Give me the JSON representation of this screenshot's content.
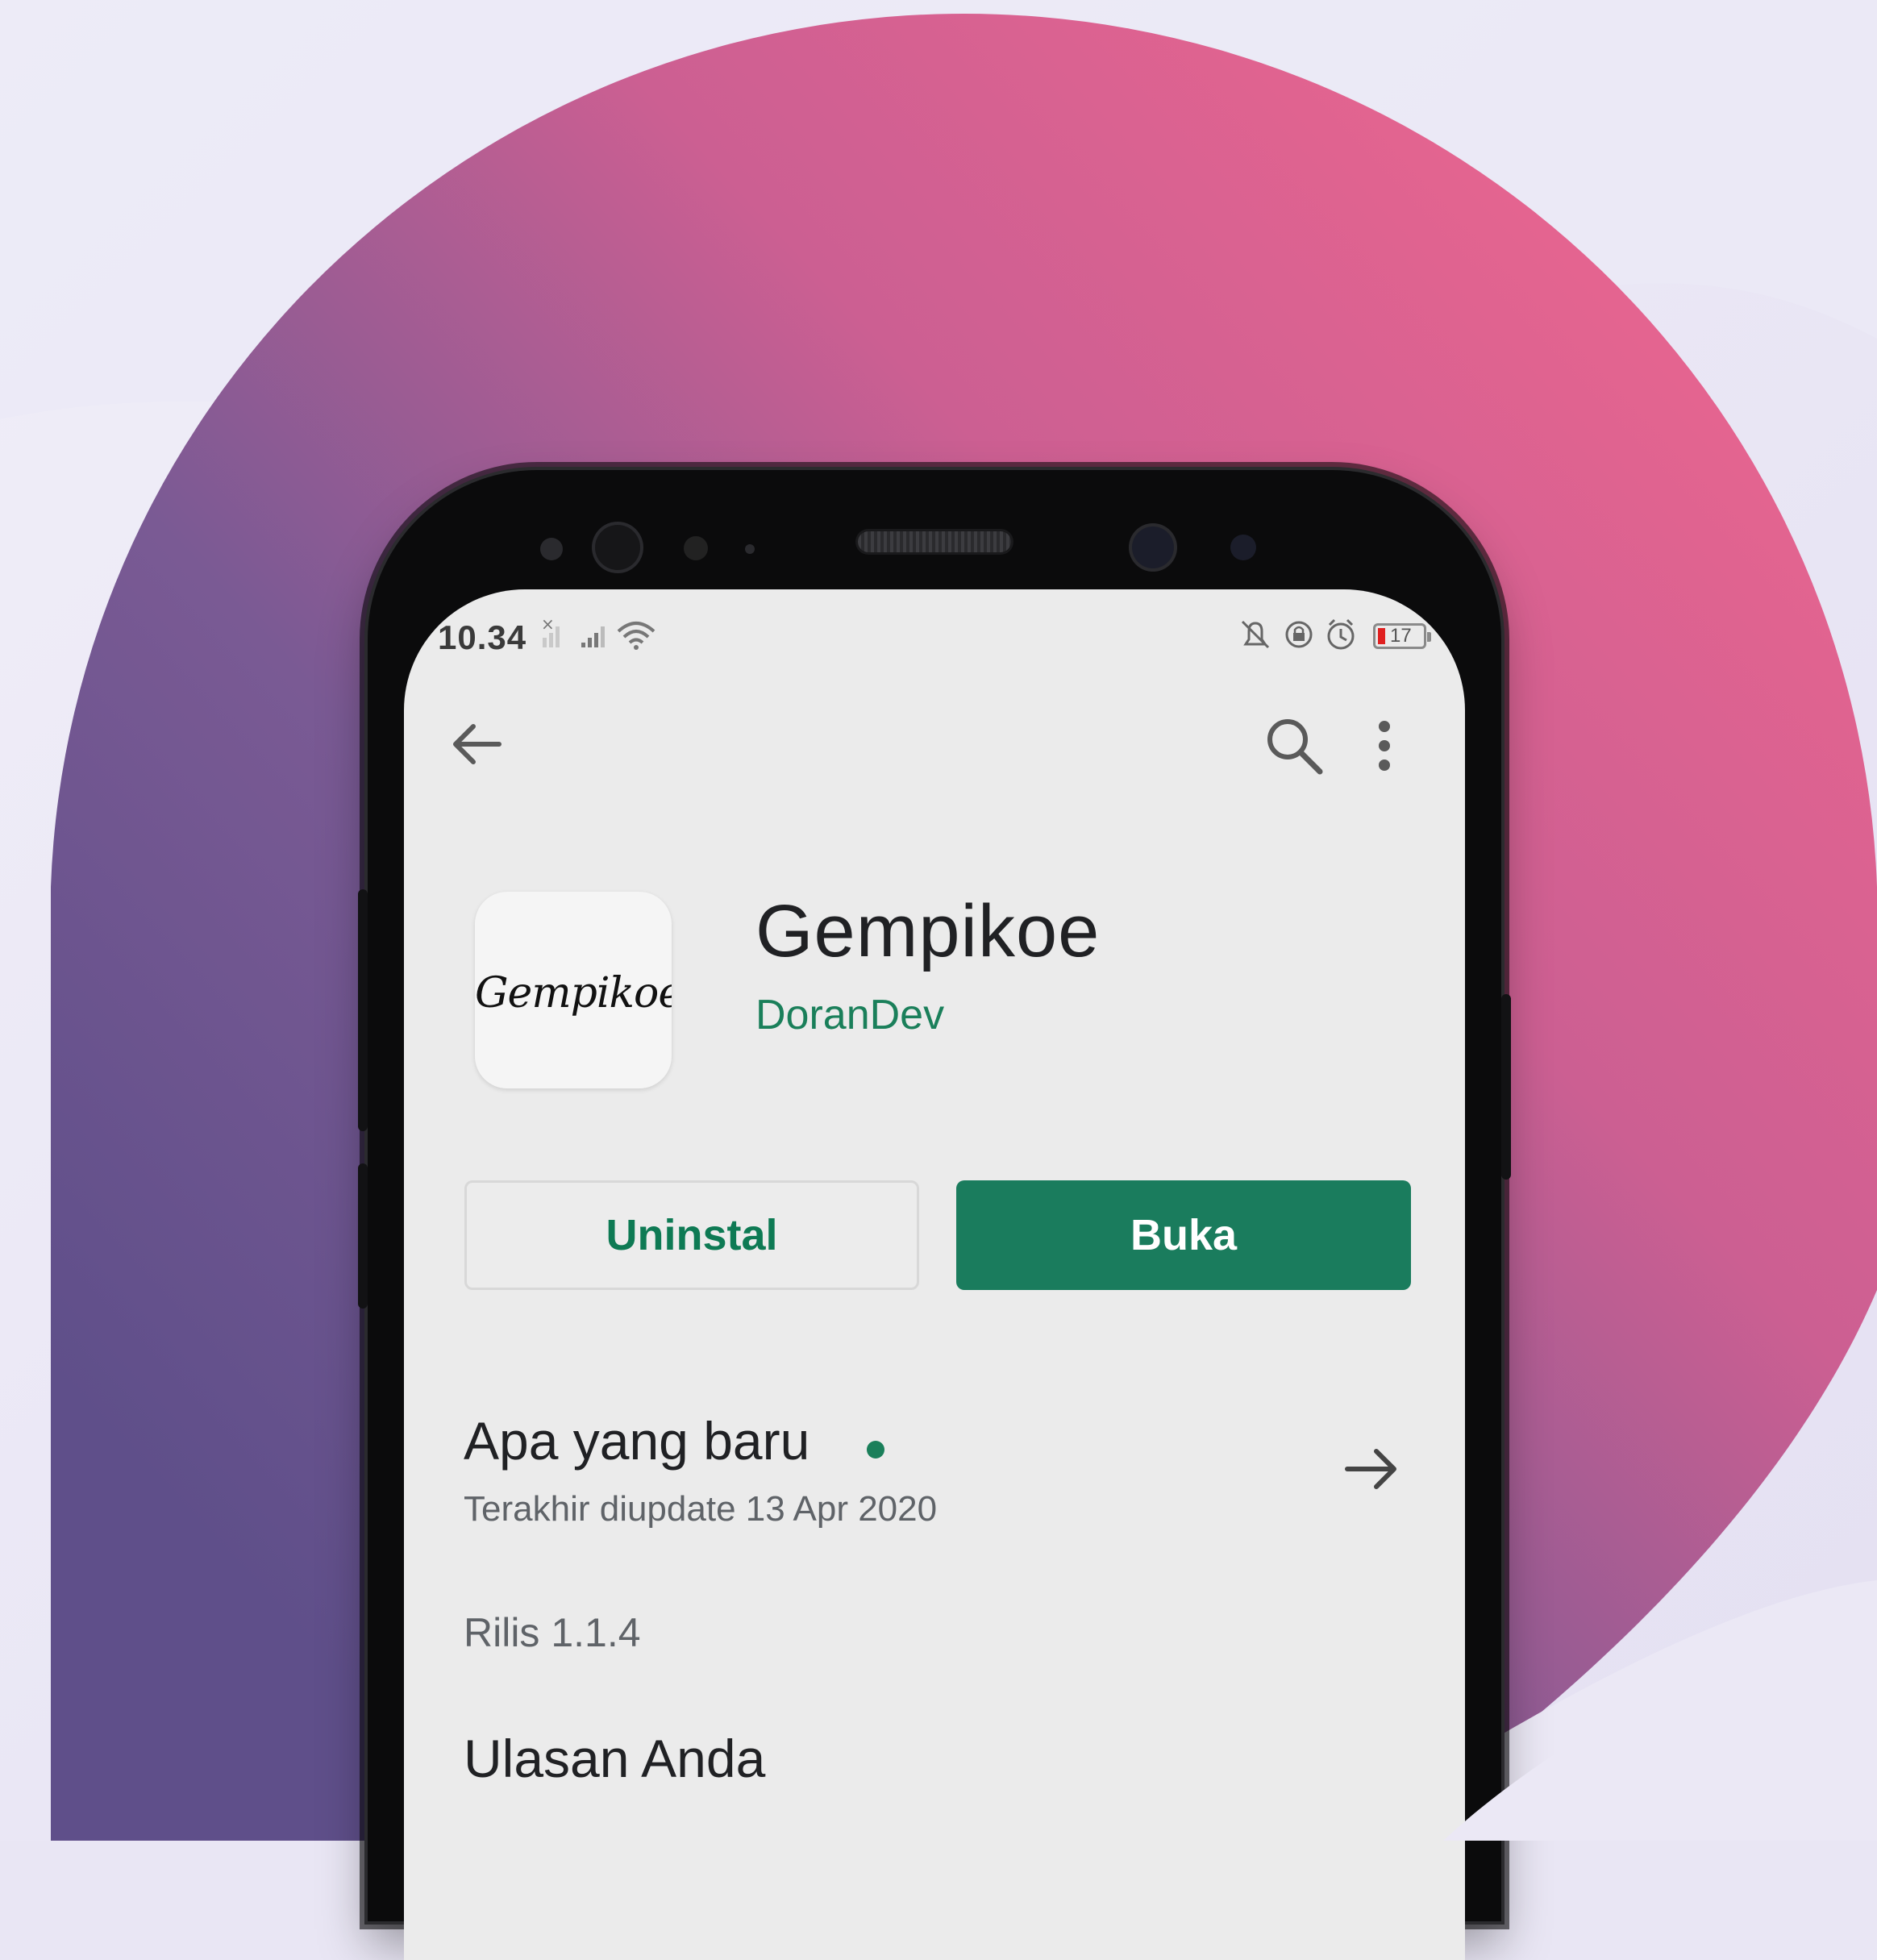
{
  "status_bar": {
    "time": "10.34",
    "battery": "17"
  },
  "toolbar": {
    "back_icon": "arrow-back-icon",
    "search_icon": "search-icon",
    "menu_icon": "more-vert-icon"
  },
  "app": {
    "icon_text": "Gempikoe",
    "title": "Gempikoe",
    "developer": "DoranDev"
  },
  "actions": {
    "uninstall_label": "Uninstal",
    "open_label": "Buka"
  },
  "whats_new": {
    "title": "Apa yang baru",
    "updated": "Terakhir diupdate 13 Apr 2020",
    "release": "Rilis 1.1.4"
  },
  "reviews": {
    "title": "Ulasan Anda"
  },
  "colors": {
    "accent_green": "#1a7c5d",
    "developer_green": "#1a7f5a",
    "screen_bg": "#ebebeb",
    "circle_gradient_start": "#5f4f8a",
    "circle_gradient_end": "#e26490"
  }
}
